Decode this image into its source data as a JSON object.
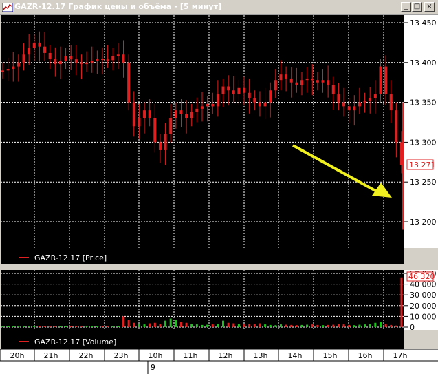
{
  "window": {
    "title": "GAZR-12.17 График цены и объёма - [5 минут]",
    "buttons": {
      "minimize": "_",
      "maximize": "□",
      "close": "×"
    }
  },
  "colors": {
    "background": "#000000",
    "grid": "#ffffff",
    "price_series": "#e02020",
    "volume_up": "#20c020",
    "volume_down": "#e02020",
    "arrow": "#f0f020",
    "axis_panel": "#ffffff"
  },
  "chart_data": [
    {
      "type": "candlestick",
      "name": "GAZR-12.17 [Price]",
      "y_ticks": [
        "13 450",
        "13 400",
        "13 350",
        "13 300",
        "13 250",
        "13 200"
      ],
      "ylim": [
        13170,
        13460
      ],
      "current_value": "13 271",
      "approx_series": [
        13390,
        13392,
        13395,
        13400,
        13410,
        13418,
        13425,
        13420,
        13412,
        13405,
        13398,
        13402,
        13408,
        13404,
        13400,
        13398,
        13400,
        13402,
        13405,
        13404,
        13403,
        13408,
        13410,
        13400,
        13350,
        13320,
        13330,
        13340,
        13330,
        13300,
        13290,
        13310,
        13330,
        13340,
        13335,
        13330,
        13338,
        13342,
        13345,
        13348,
        13345,
        13360,
        13370,
        13365,
        13360,
        13368,
        13362,
        13355,
        13350,
        13345,
        13350,
        13365,
        13378,
        13385,
        13380,
        13375,
        13372,
        13378,
        13380,
        13378,
        13375,
        13378,
        13372,
        13360,
        13350,
        13345,
        13340,
        13345,
        13350,
        13352,
        13355,
        13360,
        13395,
        13360,
        13340,
        13300,
        13271
      ]
    },
    {
      "type": "bar",
      "name": "GAZR-12.17 [Volume]",
      "y_ticks": [
        "50 000",
        "40 000",
        "30 000",
        "20 000",
        "10 000",
        "0"
      ],
      "ylim": [
        0,
        50000
      ],
      "current_value": "46 320",
      "approx_series": [
        1000,
        800,
        900,
        700,
        1200,
        600,
        900,
        800,
        700,
        600,
        800,
        900,
        700,
        600,
        800,
        700,
        900,
        800,
        700,
        600,
        900,
        800,
        700,
        10000,
        7000,
        4000,
        3000,
        2500,
        3500,
        4000,
        3000,
        6000,
        8000,
        7000,
        5000,
        4000,
        3000,
        2500,
        2000,
        2200,
        2500,
        3000,
        6000,
        4000,
        3500,
        3000,
        2500,
        3000,
        2800,
        3500,
        2500,
        2000,
        1800,
        2500,
        2200,
        2000,
        1800,
        2000,
        2200,
        2500,
        2000,
        1800,
        2000,
        2200,
        3000,
        2500,
        2000,
        1800,
        2200,
        2500,
        3000,
        4000,
        5000,
        3000,
        2000,
        1500,
        46320
      ]
    }
  ],
  "time_axis": {
    "labels": [
      "20h",
      "21h",
      "22h",
      "23h",
      "10h",
      "11h",
      "12h",
      "13h",
      "14h",
      "15h",
      "16h",
      "17h"
    ],
    "date_label": "9"
  }
}
